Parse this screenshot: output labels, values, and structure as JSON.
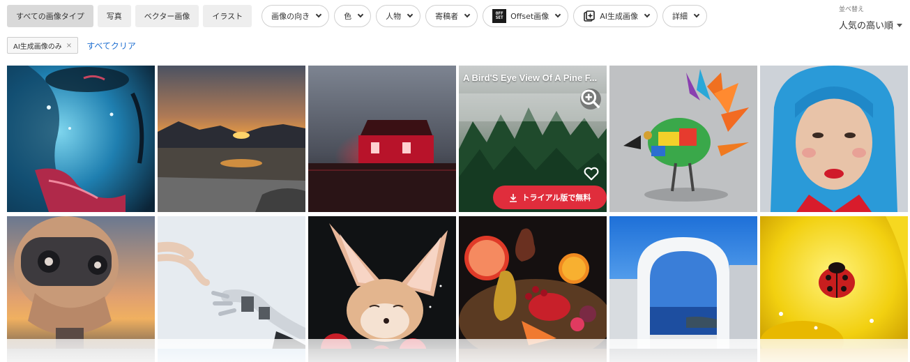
{
  "filters": {
    "types": [
      "すべての画像タイプ",
      "写真",
      "ベクター画像",
      "イラスト"
    ],
    "dropdowns": [
      "画像の向き",
      "色",
      "人物",
      "寄稿者"
    ],
    "offset_label": "Offset画像",
    "offset_logo": [
      "OFF",
      "SET"
    ],
    "ai_label": "AI生成画像",
    "detail_label": "詳細"
  },
  "sort": {
    "label": "並べ替え",
    "value": "人気の高い順"
  },
  "active_filters": {
    "chip_label": "AI生成画像のみ",
    "chip_close": "×",
    "clear_label": "すべてクリア"
  },
  "hover_card": {
    "title": "A Bird'S Eye View Of A Pine F...",
    "trial_label": "トライアル版で無料"
  },
  "images": [
    "portrait-blue-face",
    "mountain-lake-sunset",
    "red-house-fog",
    "pine-forest-aerial",
    "mechanical-bird",
    "blue-hair-portrait",
    "robot-head-sunset",
    "human-robot-hands",
    "fennec-fox-strawberries",
    "fruit-still-life",
    "arch-sea-view",
    "ladybug-yellow"
  ],
  "colors": {
    "accent_red": "#e02d3c",
    "link_blue": "#1f6fd1"
  }
}
